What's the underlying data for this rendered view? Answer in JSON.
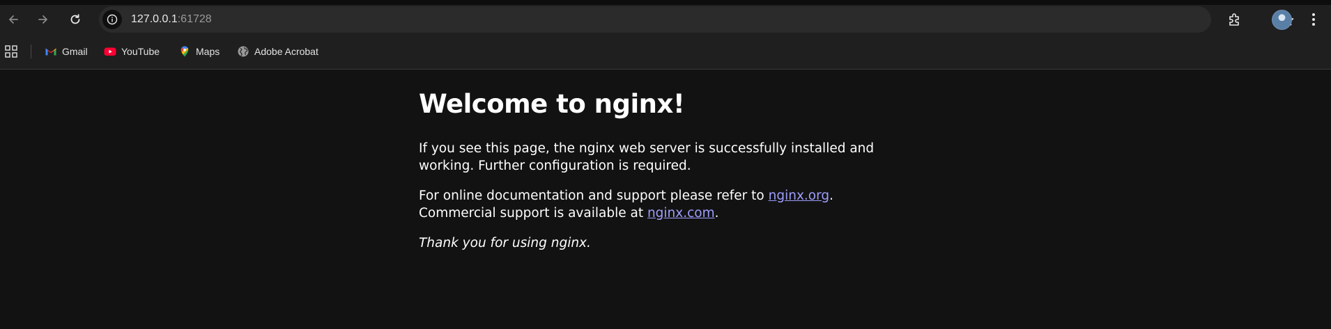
{
  "browser": {
    "url": {
      "host": "127.0.0.1",
      "port": ":61728"
    },
    "buttons": {
      "back": "back",
      "forward": "forward",
      "reload": "reload"
    },
    "bookmarks": [
      {
        "label": "Gmail",
        "icon": "gmail-icon"
      },
      {
        "label": "YouTube",
        "icon": "youtube-icon"
      },
      {
        "label": "Maps",
        "icon": "maps-icon"
      },
      {
        "label": "Adobe Acrobat",
        "icon": "globe-icon"
      }
    ],
    "colors": {
      "toolbar_bg": "#1f1f1f",
      "omnibox_bg": "#2b2b2b",
      "page_bg": "#121212",
      "link": "#9e9eff"
    }
  },
  "page": {
    "title": "Welcome to nginx!",
    "p1": "If you see this page, the nginx web server is successfully installed and working. Further configuration is required.",
    "p2_prefix": "For online documentation and support please refer to ",
    "p2_link1": "nginx.org",
    "p2_middle_a": ".",
    "p2_middle_b": "Commercial support is available at ",
    "p2_link2": "nginx.com",
    "p2_suffix": ".",
    "p3": "Thank you for using nginx."
  }
}
